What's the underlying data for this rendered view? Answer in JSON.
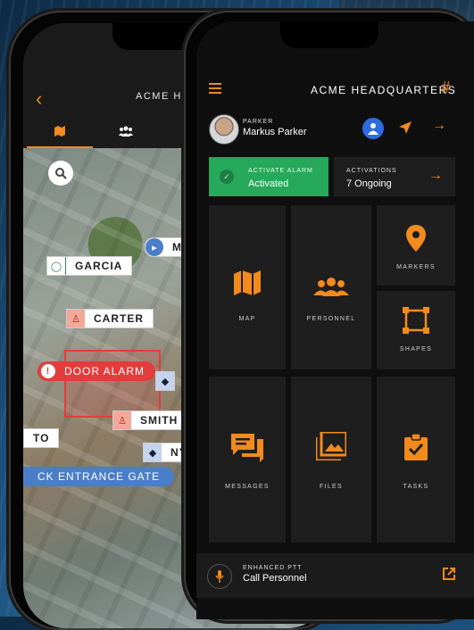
{
  "left_phone": {
    "title": "ACME HE",
    "tabs": [
      {
        "icon": "map-icon"
      },
      {
        "icon": "people-icon"
      }
    ],
    "map_labels": {
      "garcia": "GARCIA",
      "carter": "CARTER",
      "door_alarm": "DOOR ALARM",
      "smith": "SMITH",
      "to": "TO",
      "ny": "NY",
      "m": "M",
      "gate": "CK ENTRANCE GATE"
    }
  },
  "right_phone": {
    "title": "ACME HEADQUARTERS",
    "user": {
      "role": "PARKER",
      "name": "Markus Parker"
    },
    "alarm": {
      "label": "ACTIVATE ALARM",
      "status": "Activated"
    },
    "activations": {
      "label": "ACTIVATIONS",
      "count": "7 Ongoing"
    },
    "tiles": {
      "map": "MAP",
      "personnel": "PERSONNEL",
      "markers": "MARKERS",
      "shapes": "SHAPES",
      "messages": "MESSAGES",
      "files": "FILES",
      "tasks": "TASKS"
    },
    "ptt": {
      "label": "ENHANCED PTT",
      "action": "Call Personnel"
    }
  },
  "colors": {
    "accent": "#f28a1d",
    "alarm_green": "#26a95a",
    "alert_red": "#e43c3c",
    "blue": "#2e6be0"
  }
}
